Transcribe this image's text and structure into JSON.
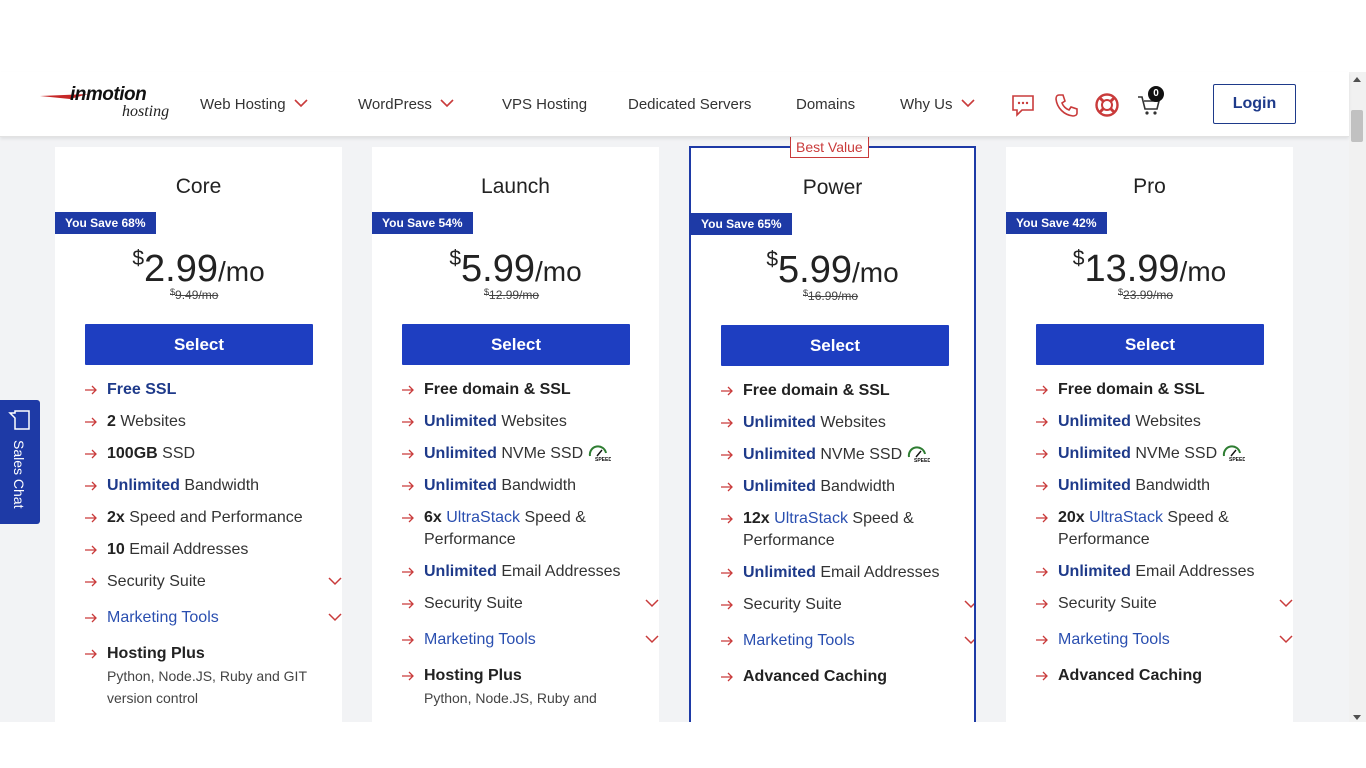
{
  "header": {
    "logo_text": "inmotion",
    "logo_sub": "hosting",
    "nav": [
      {
        "label": "Web Hosting",
        "has_dropdown": true
      },
      {
        "label": "WordPress",
        "has_dropdown": true
      },
      {
        "label": "VPS Hosting",
        "has_dropdown": false
      },
      {
        "label": "Dedicated Servers",
        "has_dropdown": false
      },
      {
        "label": "Domains",
        "has_dropdown": false
      },
      {
        "label": "Why Us",
        "has_dropdown": true
      }
    ],
    "icons": [
      "chat-icon",
      "phone-icon",
      "support-icon",
      "cart-icon"
    ],
    "cart_count": "0",
    "login_label": "Login"
  },
  "sales_chat": {
    "label": "Sales Chat"
  },
  "best_value_label": "Best Value",
  "colors": {
    "brand_blue": "#1e3ec1",
    "accent_red": "#c93b3b",
    "navy": "#1e3a8a"
  },
  "plans": [
    {
      "name": "Core",
      "save": "You Save 68%",
      "currency": "$",
      "price": "2.99",
      "per": "/mo",
      "old_currency": "$",
      "old_price": "9.49/mo",
      "select_label": "Select",
      "features": {
        "f1": {
          "bold": "Free SSL"
        },
        "f2": {
          "bold": "2",
          "text": " Websites"
        },
        "f3": {
          "bold": "100GB",
          "text": " SSD"
        },
        "f4": {
          "bold": "Unlimited",
          "text": " Bandwidth"
        },
        "f5": {
          "bold": "2x",
          "text": " Speed and Performance"
        },
        "f6": {
          "bold": "10",
          "text": " Email Addresses"
        },
        "f7": {
          "text": "Security Suite"
        },
        "f8": {
          "text": "Marketing Tools"
        },
        "f9": {
          "bold": "Hosting Plus",
          "sub": "Python, Node.JS, Ruby and GIT version control"
        }
      }
    },
    {
      "name": "Launch",
      "save": "You Save 54%",
      "currency": "$",
      "price": "5.99",
      "per": "/mo",
      "old_currency": "$",
      "old_price": "12.99/mo",
      "select_label": "Select",
      "features": {
        "f1": {
          "bold": "Free domain & SSL"
        },
        "f2": {
          "bold": "Unlimited",
          "text": " Websites"
        },
        "f3": {
          "bold": "Unlimited",
          "text": " NVMe SSD"
        },
        "f4": {
          "bold": "Unlimited",
          "text": " Bandwidth"
        },
        "f5": {
          "bold": "6x",
          "link": " UltraStack",
          "text": " Speed & Performance"
        },
        "f6": {
          "bold": "Unlimited",
          "text": " Email Addresses"
        },
        "f7": {
          "text": "Security Suite"
        },
        "f8": {
          "text": "Marketing Tools"
        },
        "f9": {
          "bold": "Hosting Plus",
          "sub": "Python, Node.JS, Ruby and"
        }
      }
    },
    {
      "name": "Power",
      "save": "You Save 65%",
      "currency": "$",
      "price": "5.99",
      "per": "/mo",
      "old_currency": "$",
      "old_price": "16.99/mo",
      "select_label": "Select",
      "features": {
        "f1": {
          "bold": "Free domain & SSL"
        },
        "f2": {
          "bold": "Unlimited",
          "text": " Websites"
        },
        "f3": {
          "bold": "Unlimited",
          "text": " NVMe SSD"
        },
        "f4": {
          "bold": "Unlimited",
          "text": " Bandwidth"
        },
        "f5": {
          "bold": "12x",
          "link": " UltraStack",
          "text": " Speed & Performance"
        },
        "f6": {
          "bold": "Unlimited",
          "text": " Email Addresses"
        },
        "f7": {
          "text": "Security Suite"
        },
        "f8": {
          "text": "Marketing Tools"
        },
        "f9": {
          "bold": "Advanced Caching"
        }
      }
    },
    {
      "name": "Pro",
      "save": "You Save 42%",
      "currency": "$",
      "price": "13.99",
      "per": "/mo",
      "old_currency": "$",
      "old_price": "23.99/mo",
      "select_label": "Select",
      "features": {
        "f1": {
          "bold": "Free domain & SSL"
        },
        "f2": {
          "bold": "Unlimited",
          "text": " Websites"
        },
        "f3": {
          "bold": "Unlimited",
          "text": " NVMe SSD"
        },
        "f4": {
          "bold": "Unlimited",
          "text": " Bandwidth"
        },
        "f5": {
          "bold": "20x",
          "link": " UltraStack",
          "text": " Speed & Performance"
        },
        "f6": {
          "bold": "Unlimited",
          "text": " Email Addresses"
        },
        "f7": {
          "text": "Security Suite"
        },
        "f8": {
          "text": "Marketing Tools"
        },
        "f9": {
          "bold": "Advanced Caching"
        }
      }
    }
  ]
}
